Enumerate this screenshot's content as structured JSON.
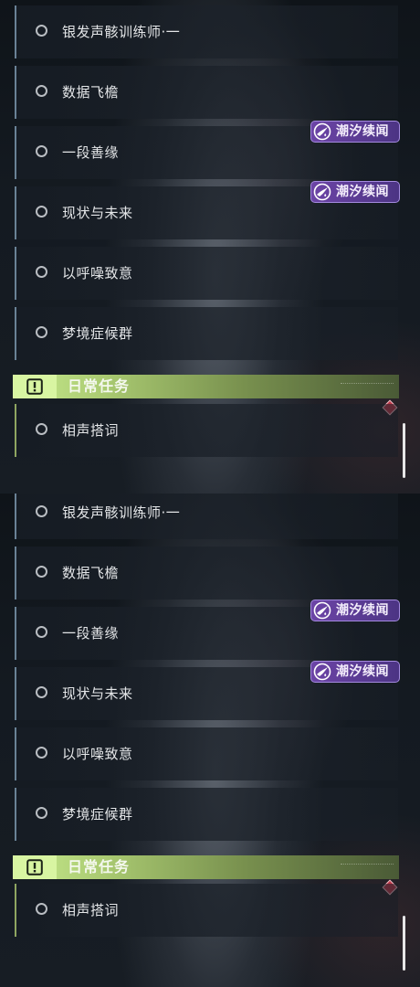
{
  "panels": [
    {
      "quests": [
        {
          "label": "银发声骸训练师·一"
        },
        {
          "label": "数据飞檐"
        },
        {
          "label": "一段善缘"
        },
        {
          "label": "现状与未来"
        },
        {
          "label": "以呼噪致意"
        },
        {
          "label": "梦境症候群"
        }
      ],
      "tags": [
        {
          "label": "潮汐续闻",
          "icon": "tidal-tale-icon"
        },
        {
          "label": "潮汐续闻",
          "icon": "tidal-tale-icon"
        }
      ],
      "daily_section": {
        "title": "日常任务",
        "icon": "exclamation-icon",
        "quests": [
          {
            "label": "相声搭词"
          }
        ]
      }
    },
    {
      "quests": [
        {
          "label": "银发声骸训练师·一"
        },
        {
          "label": "数据飞檐"
        },
        {
          "label": "一段善缘"
        },
        {
          "label": "现状与未来"
        },
        {
          "label": "以呼噪致意"
        },
        {
          "label": "梦境症候群"
        }
      ],
      "tags": [
        {
          "label": "潮汐续闻",
          "icon": "tidal-tale-icon"
        },
        {
          "label": "潮汐续闻",
          "icon": "tidal-tale-icon"
        }
      ],
      "daily_section": {
        "title": "日常任务",
        "icon": "exclamation-icon",
        "quests": [
          {
            "label": "相声搭词"
          }
        ]
      }
    }
  ],
  "colors": {
    "quest_accent": "#6a8296",
    "daily_accent": "#c8ec8e",
    "tag_purple": "#6c44a6",
    "alert_red": "#c0394a"
  }
}
